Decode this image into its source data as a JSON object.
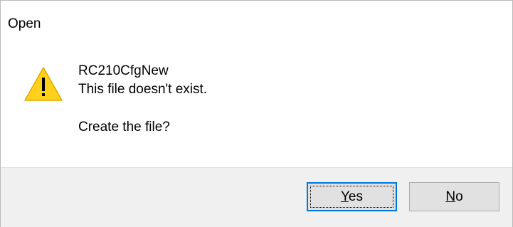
{
  "window": {
    "title": "Open"
  },
  "message": {
    "icon": "warning-icon",
    "filename": "RC210CfgNew",
    "line1": "This file doesn't exist.",
    "question": "Create the file?"
  },
  "buttons": {
    "yes": {
      "mnemonic": "Y",
      "rest": "es"
    },
    "no": {
      "mnemonic": "N",
      "rest": "o"
    }
  },
  "colors": {
    "warning_fill": "#ffd11a",
    "focus_border": "#0078d7",
    "footer_bg": "#f0f0f0",
    "button_bg": "#e1e1e1"
  }
}
